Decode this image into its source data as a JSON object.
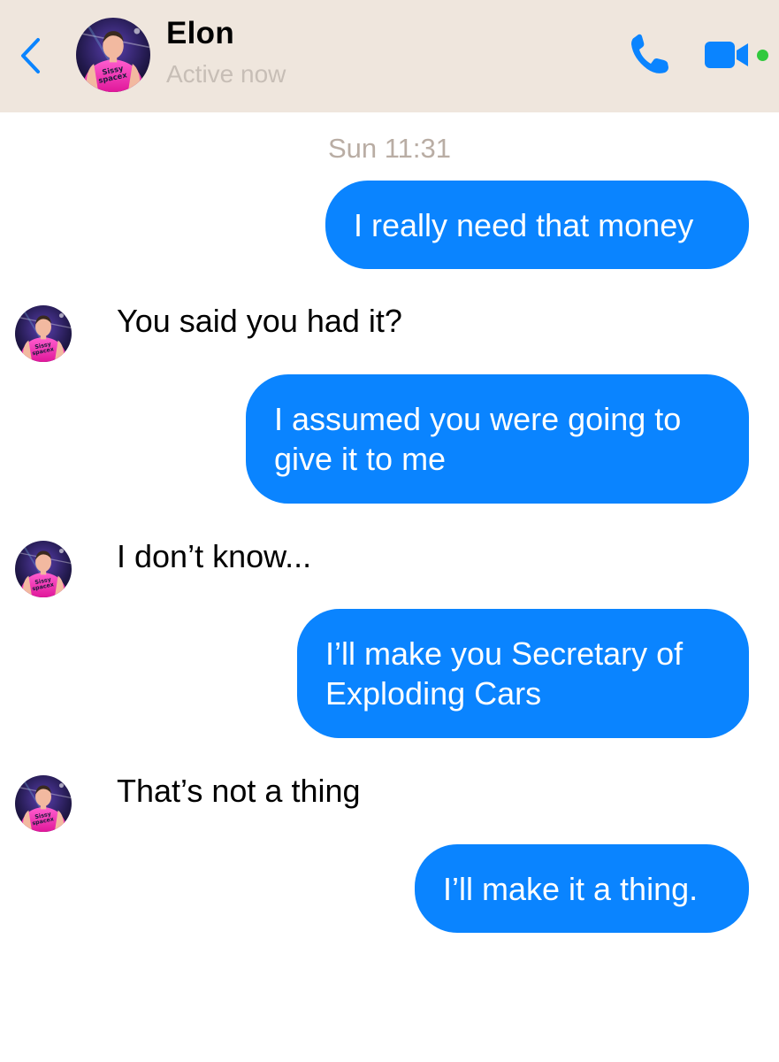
{
  "header": {
    "contact_name": "Elon",
    "status": "Active now",
    "accent_color": "#0a84ff",
    "online_color": "#31c93d",
    "icons": [
      "chevron-left-icon",
      "phone-icon",
      "video-camera-icon"
    ]
  },
  "conversation": {
    "timestamp": "Sun 11:31",
    "messages": [
      {
        "from": "me",
        "text": "I really need that money"
      },
      {
        "from": "Elon",
        "text": "You said you had it?"
      },
      {
        "from": "me",
        "text": "I assumed you were going to give it to me"
      },
      {
        "from": "Elon",
        "text": "I don’t know..."
      },
      {
        "from": "me",
        "text": "I’ll make you Secretary of Exploding Cars"
      },
      {
        "from": "Elon",
        "text": "That’s not a thing"
      },
      {
        "from": "me",
        "text": "I’ll make it a thing."
      }
    ]
  }
}
